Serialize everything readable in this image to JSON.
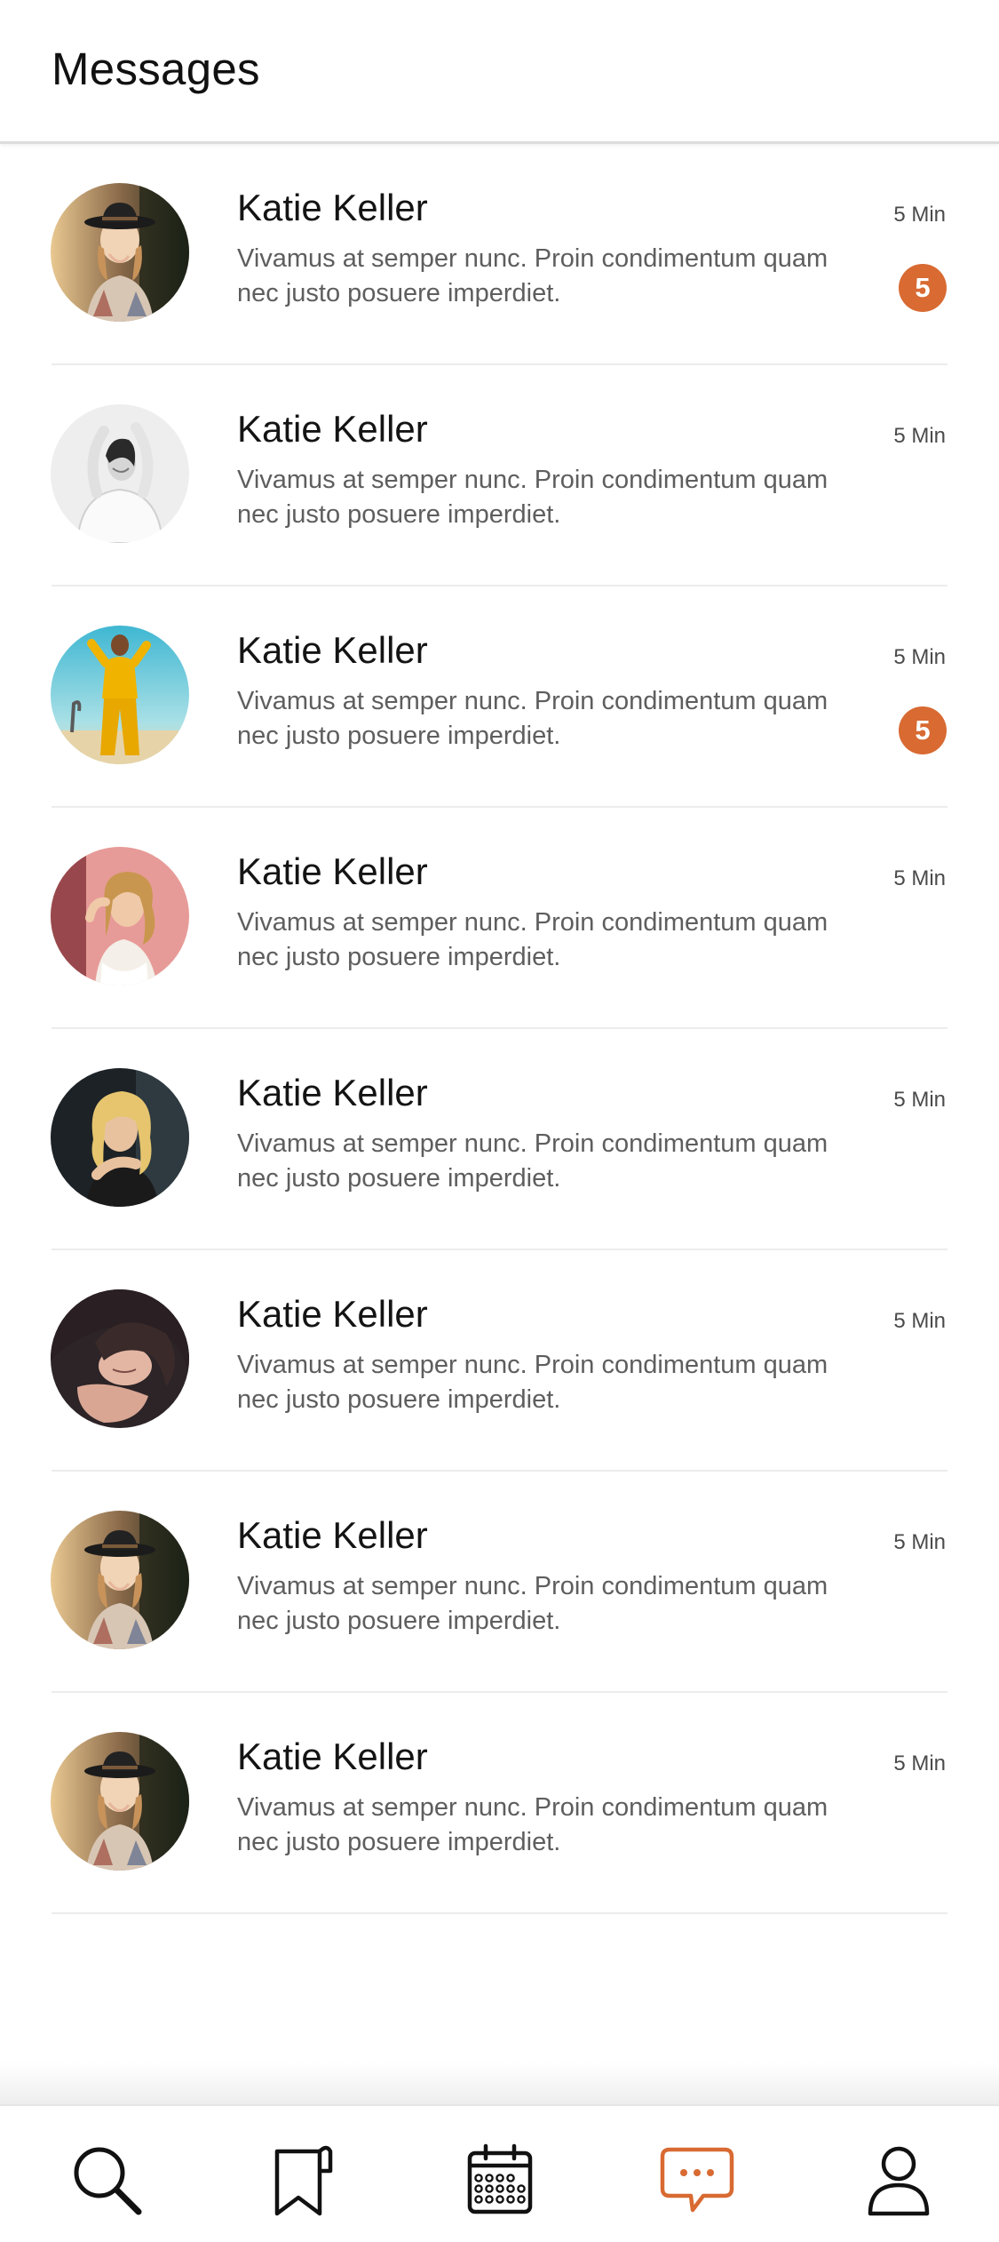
{
  "header": {
    "title": "Messages"
  },
  "messages": [
    {
      "name": "Katie Keller",
      "preview": "Vivamus at semper nunc. Proin condimentum quam nec justo posuere imperdiet.",
      "time": "5 Min",
      "unread": "5",
      "avatar": "avatar-hat"
    },
    {
      "name": "Katie Keller",
      "preview": "Vivamus at semper nunc. Proin condimentum quam nec justo posuere imperdiet.",
      "time": "5 Min",
      "unread": "",
      "avatar": "avatar-bw"
    },
    {
      "name": "Katie Keller",
      "preview": "Vivamus at semper nunc. Proin condimentum quam nec justo posuere imperdiet.",
      "time": "5 Min",
      "unread": "5",
      "avatar": "avatar-yellow"
    },
    {
      "name": "Katie Keller",
      "preview": "Vivamus at semper nunc. Proin condimentum quam nec justo posuere imperdiet.",
      "time": "5 Min",
      "unread": "",
      "avatar": "avatar-pink"
    },
    {
      "name": "Katie Keller",
      "preview": "Vivamus at semper nunc. Proin condimentum quam nec justo posuere imperdiet.",
      "time": "5 Min",
      "unread": "",
      "avatar": "avatar-blonde"
    },
    {
      "name": "Katie Keller",
      "preview": "Vivamus at semper nunc. Proin condimentum quam nec justo posuere imperdiet.",
      "time": "5 Min",
      "unread": "",
      "avatar": "avatar-curly"
    },
    {
      "name": "Katie Keller",
      "preview": "Vivamus at semper nunc. Proin condimentum quam nec justo posuere imperdiet.",
      "time": "5 Min",
      "unread": "",
      "avatar": "avatar-hat"
    },
    {
      "name": "Katie Keller",
      "preview": "Vivamus at semper nunc. Proin condimentum quam nec justo posuere imperdiet.",
      "time": "5 Min",
      "unread": "",
      "avatar": "avatar-hat"
    }
  ],
  "tabbar": {
    "items": [
      {
        "icon": "search-icon",
        "active": false
      },
      {
        "icon": "bookmark-icon",
        "active": false
      },
      {
        "icon": "calendar-icon",
        "active": false
      },
      {
        "icon": "chat-icon",
        "active": true
      },
      {
        "icon": "profile-icon",
        "active": false
      }
    ]
  },
  "colors": {
    "accent": "#d86a32",
    "name": "#141414",
    "preview": "#5e5e5e",
    "divider": "#ececec",
    "icon": "#111111"
  }
}
